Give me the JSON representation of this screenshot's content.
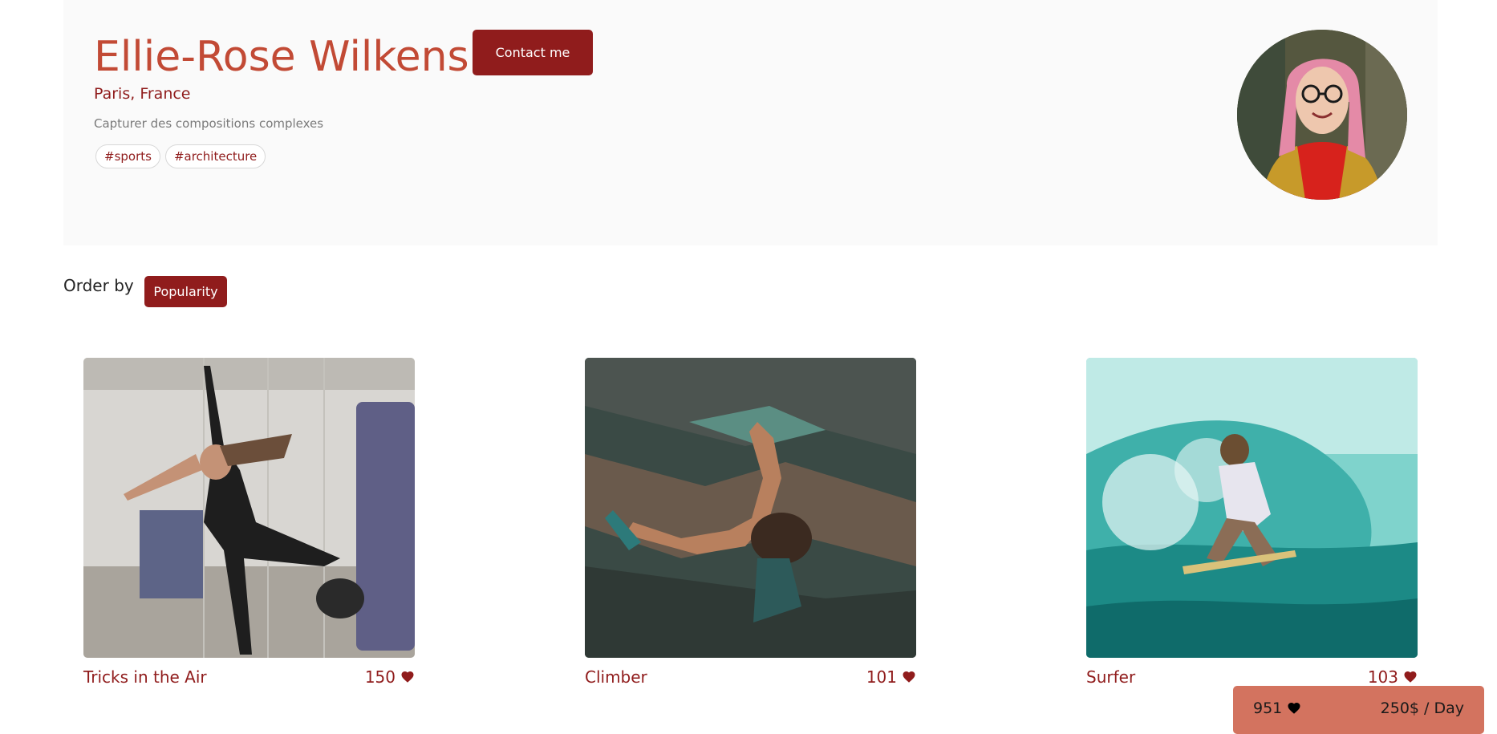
{
  "profile": {
    "name": "Ellie-Rose Wilkens",
    "location": "Paris, France",
    "tagline": "Capturer des compositions complexes",
    "tags": [
      "#sports",
      "#architecture"
    ],
    "contact_label": "Contact me"
  },
  "sort": {
    "label": "Order by",
    "selected": "Popularity"
  },
  "media": [
    {
      "title": "Tricks in the Air",
      "likes": "150"
    },
    {
      "title": "Climber",
      "likes": "101"
    },
    {
      "title": "Surfer",
      "likes": "103"
    }
  ],
  "footer": {
    "total_likes": "951",
    "price": "250$ / Day"
  },
  "colors": {
    "primary": "#901c1c",
    "name": "#c24a35",
    "footer_bg": "#d3735f",
    "header_bg": "#fafafa"
  },
  "icons": {
    "like": "heart-icon"
  }
}
